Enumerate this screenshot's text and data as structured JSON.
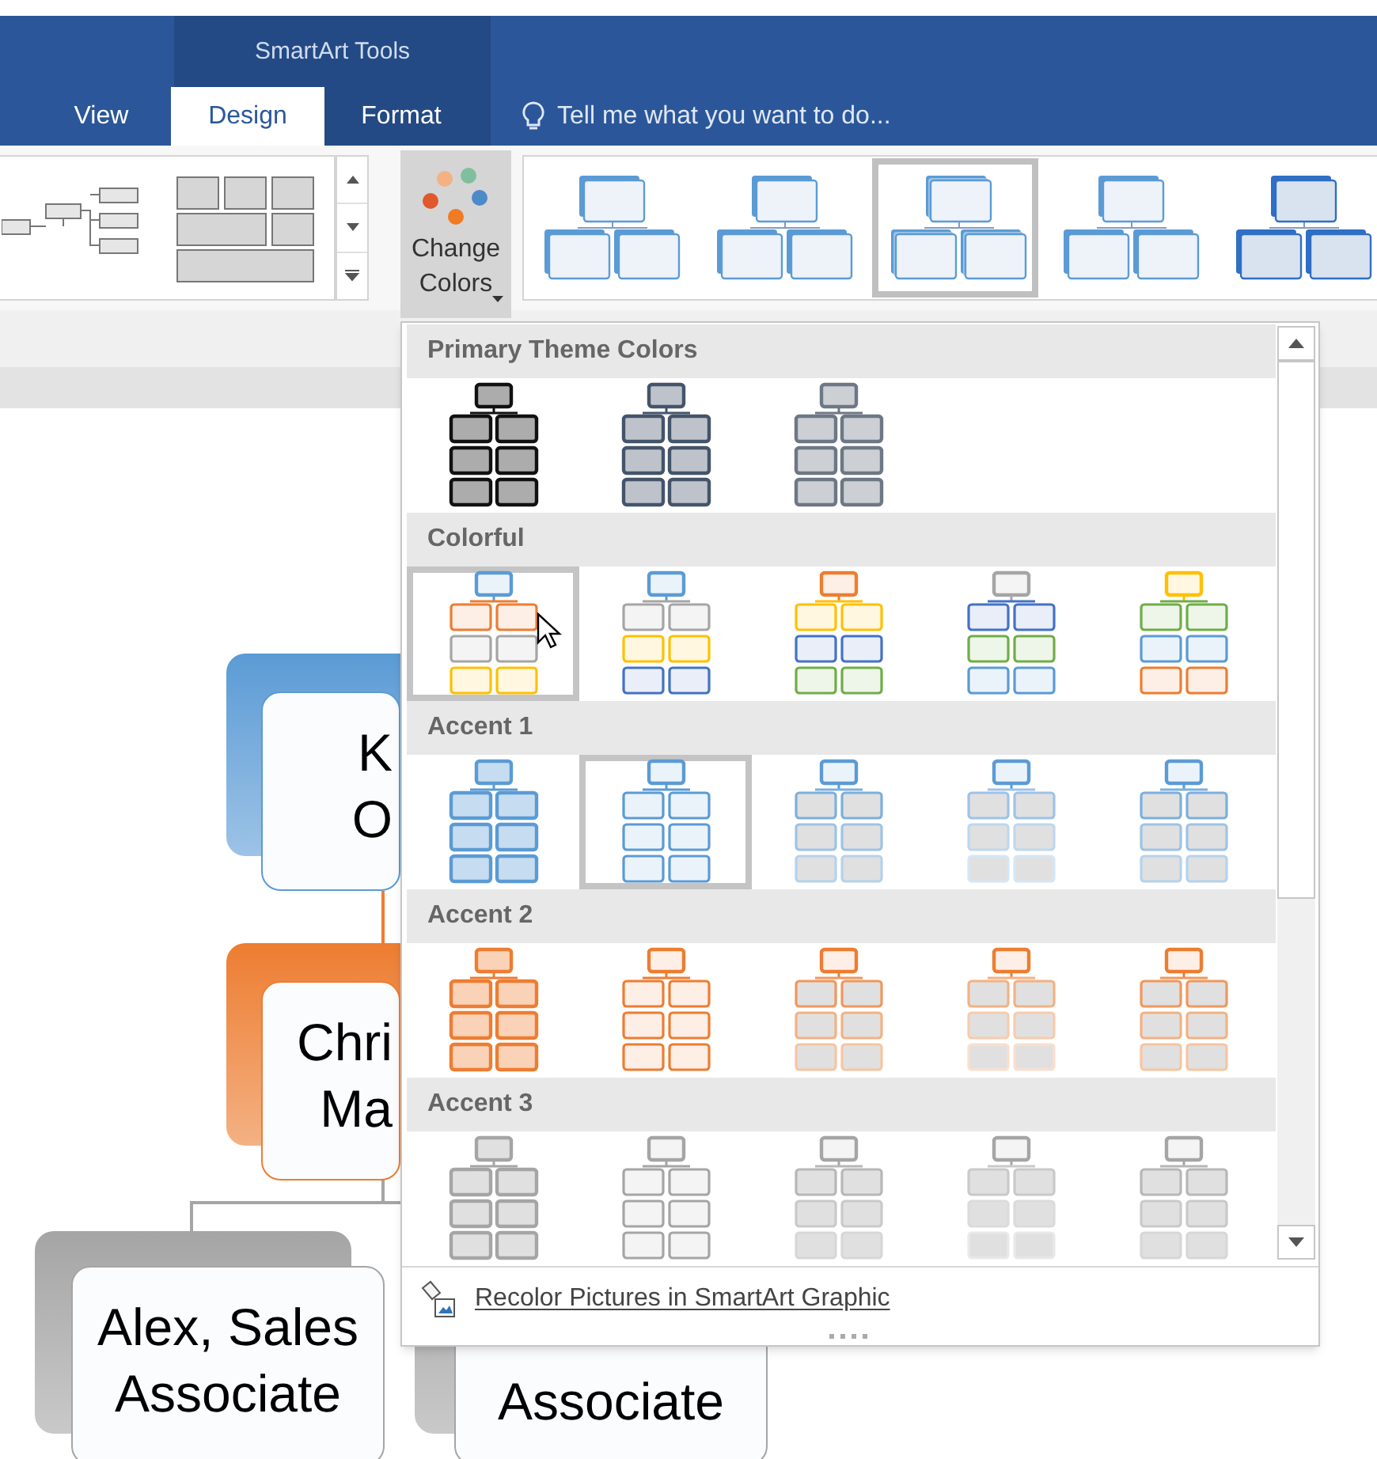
{
  "context_tab": {
    "label": "SmartArt Tools"
  },
  "tabs": [
    {
      "label": "View",
      "selected": false
    },
    {
      "label": "Design",
      "selected": true
    },
    {
      "label": "Format",
      "selected": false
    }
  ],
  "tell_me": {
    "placeholder": "Tell me what you want to do..."
  },
  "change_colors_button": {
    "label": "Change Colors"
  },
  "style_gallery": [
    {
      "kind": "flat",
      "selected": false
    },
    {
      "kind": "flat",
      "selected": false
    },
    {
      "kind": "stacked",
      "selected": true
    },
    {
      "kind": "flat",
      "selected": false
    },
    {
      "kind": "bold",
      "selected": false
    }
  ],
  "org_chart": [
    {
      "lines": [
        "K",
        "O"
      ],
      "color": "#5b9bd5"
    },
    {
      "lines": [
        "Chri",
        "Ma"
      ],
      "color": "#ed7d31"
    },
    {
      "lines": [
        "Alex, Sales",
        "Associate"
      ],
      "color": "#a5a5a5"
    },
    {
      "lines": [
        "Associate"
      ],
      "color": "#a5a5a5"
    }
  ],
  "color_menu": {
    "sections": [
      {
        "title": "Primary Theme Colors",
        "items": [
          {
            "kind": "filled",
            "color": "#111111",
            "selected": false
          },
          {
            "kind": "filled",
            "color": "#44546a",
            "selected": false
          },
          {
            "kind": "filled",
            "color": "#6e7785",
            "selected": false
          }
        ]
      },
      {
        "title": "Colorful",
        "items": [
          {
            "kind": "colorful",
            "color": "#5b9bd5",
            "selected": true
          },
          {
            "kind": "colorful",
            "color": "#5b9bd5",
            "selected": false
          },
          {
            "kind": "colorful",
            "color": "#ed7d31",
            "selected": false
          },
          {
            "kind": "colorful",
            "color": "#a5a5a5",
            "selected": false
          },
          {
            "kind": "colorful",
            "color": "#ffc000",
            "selected": false
          }
        ]
      },
      {
        "title": "Accent 1",
        "items": [
          {
            "kind": "filled",
            "color": "#5b9bd5",
            "selected": false
          },
          {
            "kind": "outline",
            "color": "#5b9bd5",
            "selected": true
          },
          {
            "kind": "fade",
            "color": "#5b9bd5",
            "selected": false
          },
          {
            "kind": "faint",
            "color": "#5b9bd5",
            "selected": false
          },
          {
            "kind": "fade",
            "color": "#5b9bd5",
            "selected": false
          }
        ]
      },
      {
        "title": "Accent 2",
        "items": [
          {
            "kind": "filled",
            "color": "#ed7d31",
            "selected": false
          },
          {
            "kind": "outline",
            "color": "#ed7d31",
            "selected": false
          },
          {
            "kind": "fade",
            "color": "#ed7d31",
            "selected": false
          },
          {
            "kind": "faint",
            "color": "#ed7d31",
            "selected": false
          },
          {
            "kind": "fade",
            "color": "#ed7d31",
            "selected": false
          }
        ]
      },
      {
        "title": "Accent 3",
        "items": [
          {
            "kind": "filled",
            "color": "#a5a5a5",
            "selected": false
          },
          {
            "kind": "outline",
            "color": "#a5a5a5",
            "selected": false
          },
          {
            "kind": "fade",
            "color": "#a5a5a5",
            "selected": false
          },
          {
            "kind": "faint",
            "color": "#a5a5a5",
            "selected": false
          },
          {
            "kind": "fade",
            "color": "#a5a5a5",
            "selected": false
          }
        ]
      }
    ],
    "footer": {
      "label": "Recolor Pictures in SmartArt Graphic"
    }
  }
}
